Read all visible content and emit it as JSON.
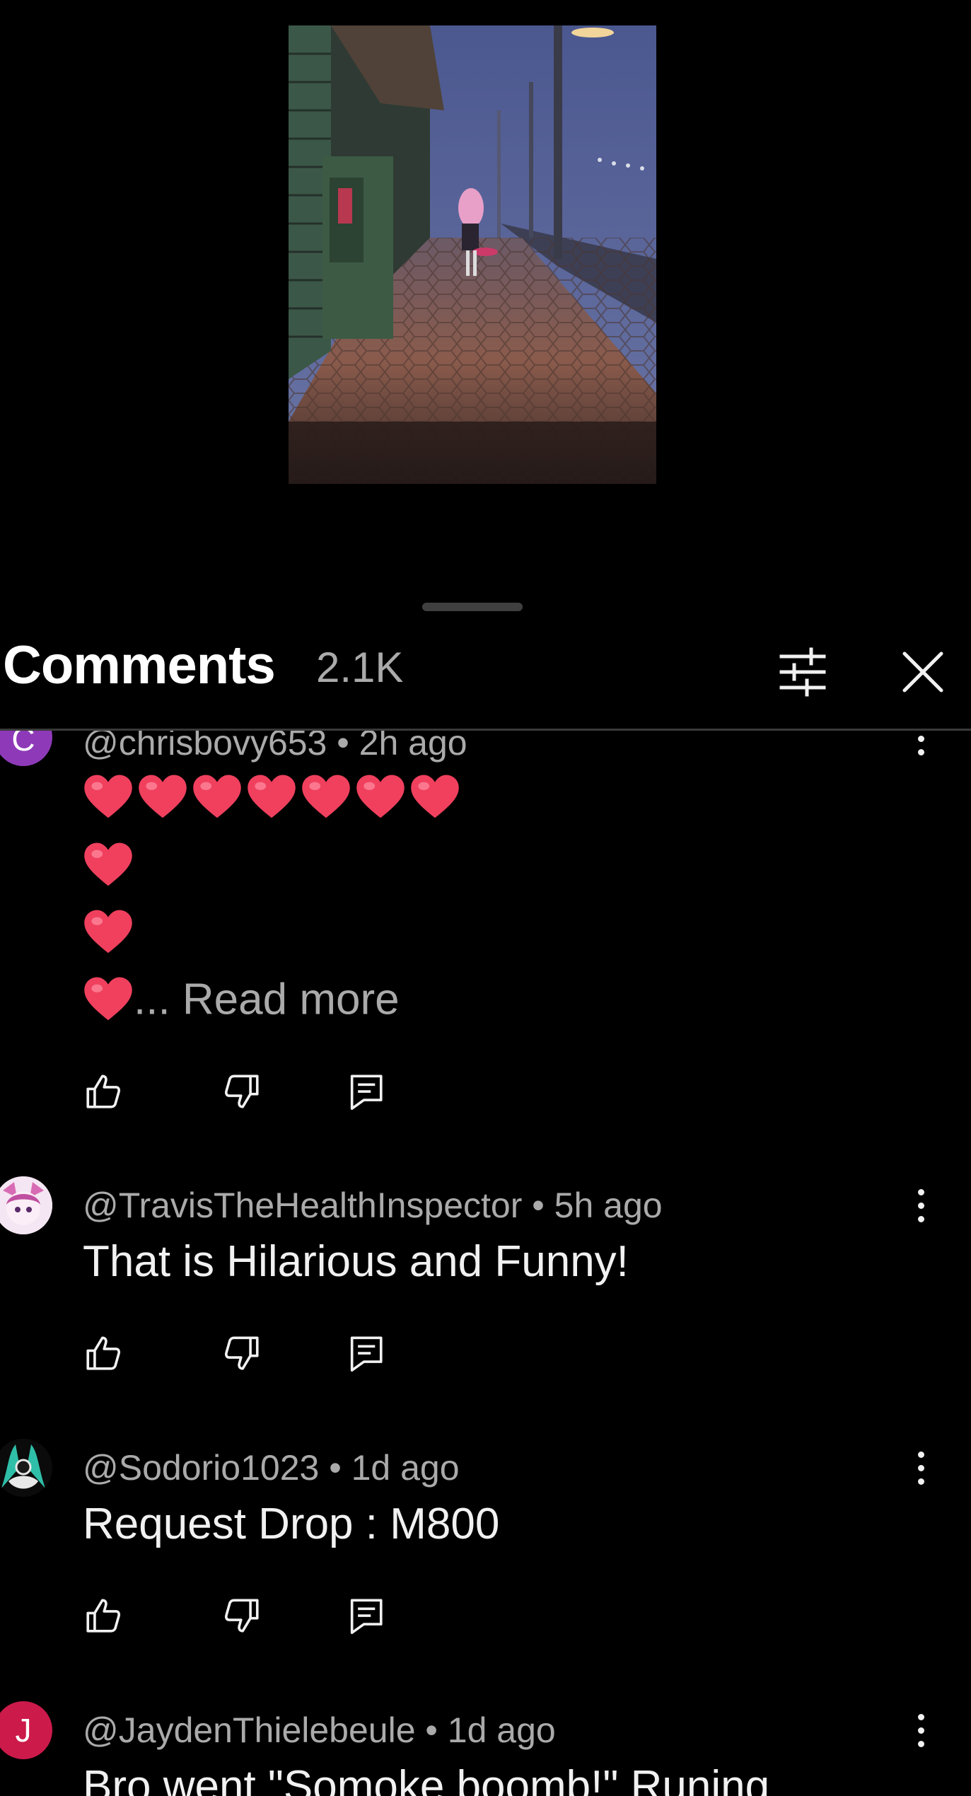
{
  "header": {
    "title": "Comments",
    "count": "2.1K",
    "filter_icon": "sliders-icon",
    "close_icon": "close-icon"
  },
  "comments": [
    {
      "avatar_letter": "C",
      "avatar_color": "#8e3ab8",
      "meta": "@chrisbovy653 • 2h ago",
      "body_emoji": "heart",
      "read_more": "... Read more"
    },
    {
      "avatar_color": "#f0d9ee",
      "meta": "@TravisTheHealthInspector • 5h ago",
      "body": "That is Hilarious and Funny!"
    },
    {
      "avatar_color": "#0b0b0b",
      "meta": "@Sodorio1023 • 1d ago",
      "body": "Request Drop : M800"
    },
    {
      "avatar_letter": "J",
      "avatar_color": "#cc1a4a",
      "meta": "@JaydenThielebeule • 1d ago",
      "body": "Bro went \"Somoke boomb!\" Runing"
    }
  ],
  "icons": {
    "like": "thumbs-up-icon",
    "dislike": "thumbs-down-icon",
    "reply": "reply-icon",
    "more": "more-vert-icon"
  }
}
